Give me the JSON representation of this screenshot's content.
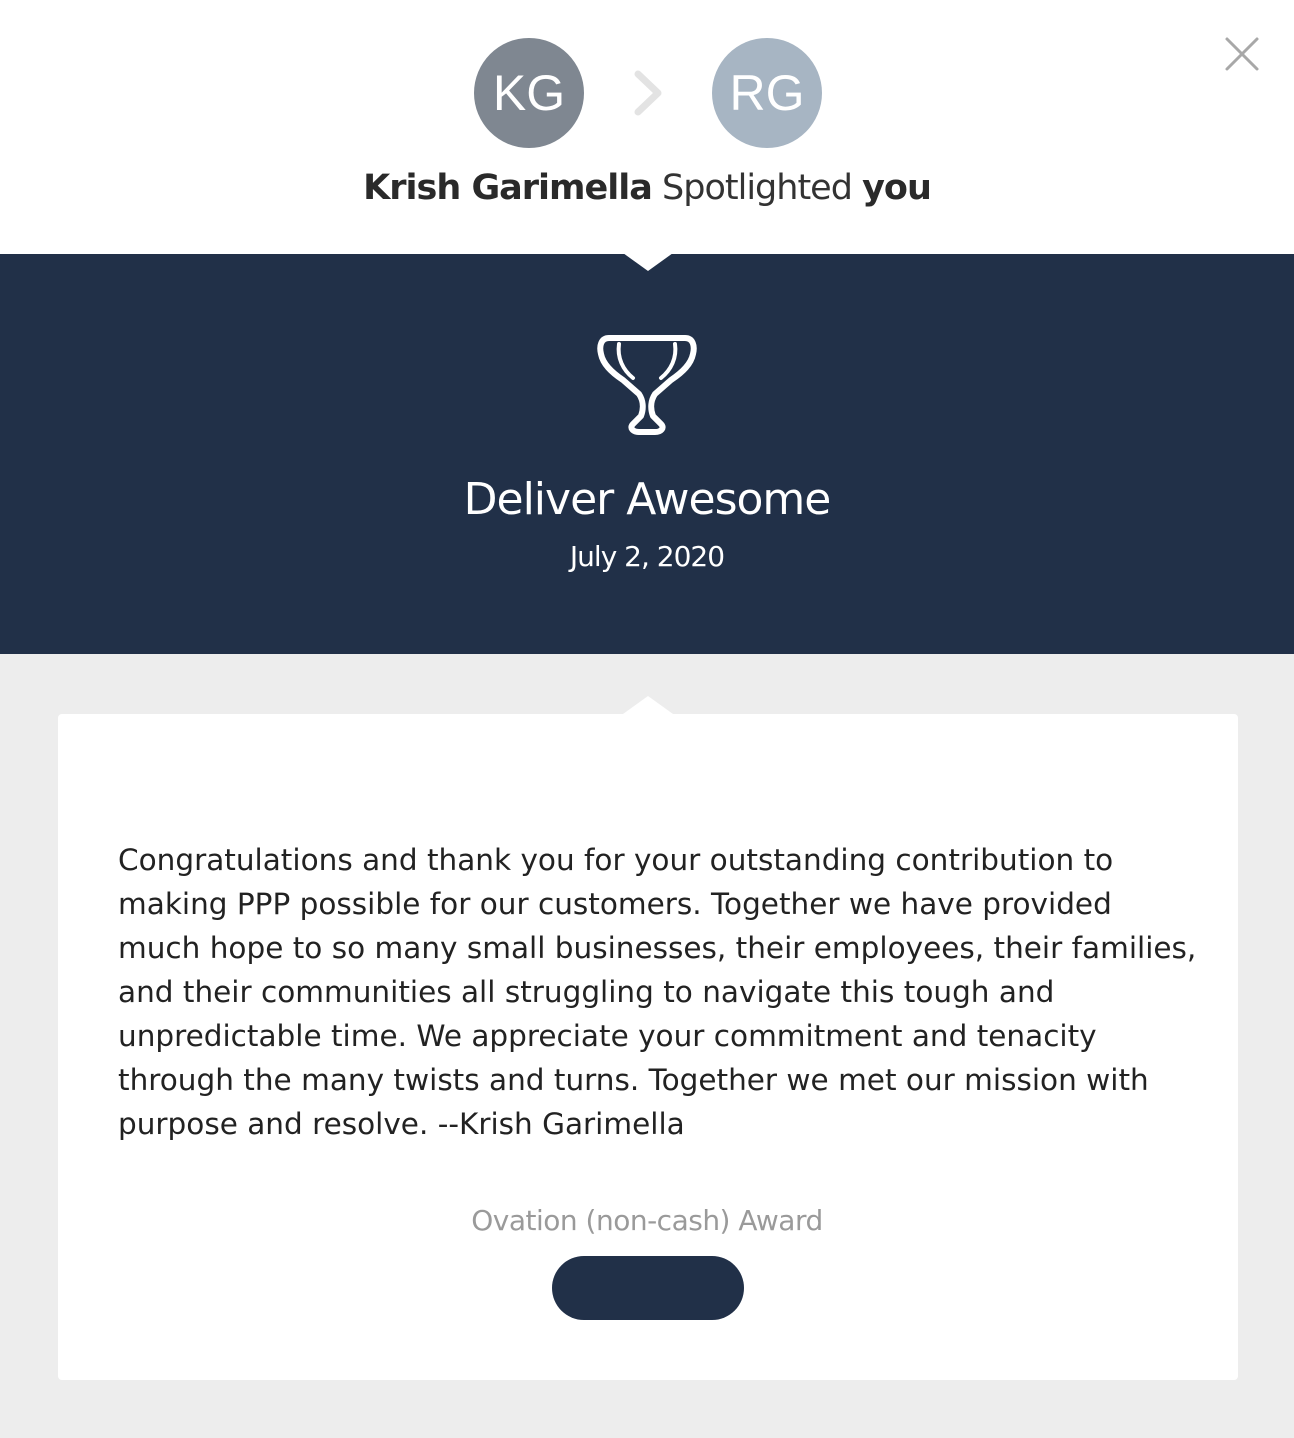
{
  "header": {
    "sender_initials": "KG",
    "recipient_initials": "RG",
    "sender_name": "Krish Garimella",
    "verb": "Spotlighted",
    "recipient": "you"
  },
  "award": {
    "title": "Deliver Awesome",
    "date": "July 2, 2020",
    "icon": "trophy-icon"
  },
  "message": {
    "text": "Congratulations and thank you for your outstanding contribution to making PPP possible for our customers. Together we have provided much hope to so many small businesses, their employees, their families, and their communities all struggling to navigate this tough and unpredictable time. We appreciate your commitment and tenacity through the many twists and turns. Together we met our mission with purpose and resolve. --Krish Garimella"
  },
  "award_type": "Ovation (non-cash) Award",
  "action_button_label": "",
  "colors": {
    "navy": "#213048",
    "sender_avatar": "#7f8791",
    "recipient_avatar": "#a7b5c3",
    "page_background": "#ededed"
  }
}
